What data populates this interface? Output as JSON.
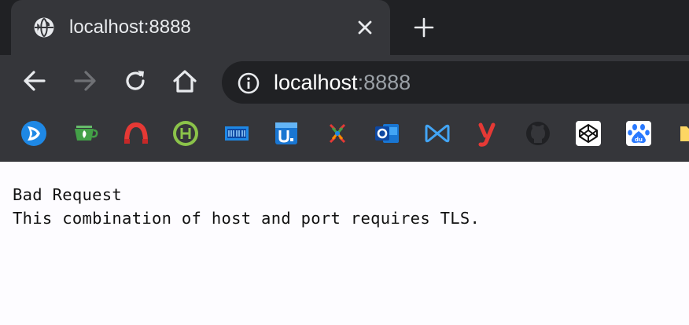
{
  "tab": {
    "title": "localhost:8888",
    "favicon": "globe-icon",
    "close_icon": "close-icon",
    "new_tab_icon": "plus-icon"
  },
  "toolbar": {
    "back_icon": "back-arrow-icon",
    "forward_icon": "forward-arrow-icon",
    "reload_icon": "reload-icon",
    "home_icon": "home-icon",
    "site_info_icon": "info-icon",
    "url_host": "localhost",
    "url_port": ":8888"
  },
  "bookmarks": [
    "bookmark-blue-circle-icon",
    "bookmark-green-cup-icon",
    "bookmark-red-arc-icon",
    "bookmark-green-h-icon",
    "bookmark-blue-bar-icon",
    "bookmark-blue-u-icon",
    "bookmark-multicolor-icon",
    "bookmark-outlook-icon",
    "bookmark-bowtie-icon",
    "bookmark-red-y-icon",
    "bookmark-github-icon",
    "bookmark-codepen-icon",
    "bookmark-baidu-icon",
    "bookmark-folder-icon"
  ],
  "content": {
    "heading": "Bad Request",
    "message": "This combination of host and port requires TLS."
  },
  "colors": {
    "tabstrip": "#202124",
    "toolbar": "#35363a",
    "omnibox": "#202124",
    "page_bg": "#fdfcff",
    "text": "#111111"
  }
}
